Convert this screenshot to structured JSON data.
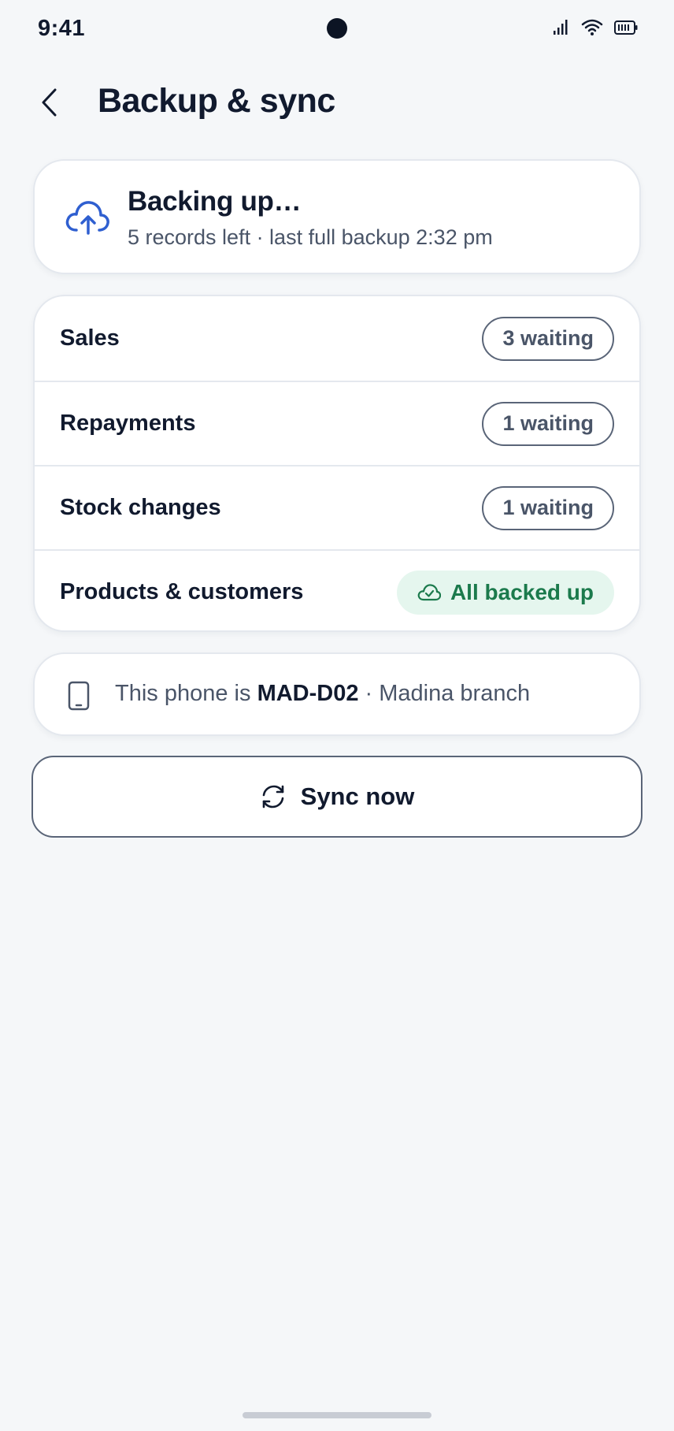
{
  "status_bar": {
    "time": "9:41",
    "icons": [
      "signal-icon",
      "wifi-icon",
      "battery-icon"
    ]
  },
  "header": {
    "title": "Backup & sync",
    "back_icon": "chevron-left-icon"
  },
  "status": {
    "icon": "cloud-upload-icon",
    "title": "Backing up…",
    "subtitle": "5 records left · last full backup 2:32 pm"
  },
  "categories": [
    {
      "label": "Sales",
      "badge": "3 waiting",
      "state": "waiting"
    },
    {
      "label": "Repayments",
      "badge": "1 waiting",
      "state": "waiting"
    },
    {
      "label": "Stock changes",
      "badge": "1 waiting",
      "state": "waiting"
    },
    {
      "label": "Products & customers",
      "badge": "All backed up",
      "state": "done"
    }
  ],
  "device": {
    "icon": "phone-icon",
    "prefix": "This phone is",
    "device_id": "MAD-D02",
    "suffix": "· Madina branch"
  },
  "sync_button": {
    "icon": "sync-icon",
    "label": "Sync now"
  },
  "colors": {
    "accent": "#2f5fd0",
    "success": "#1b7a4c",
    "success_bg": "#e5f6ee",
    "background": "#f5f7f9"
  }
}
